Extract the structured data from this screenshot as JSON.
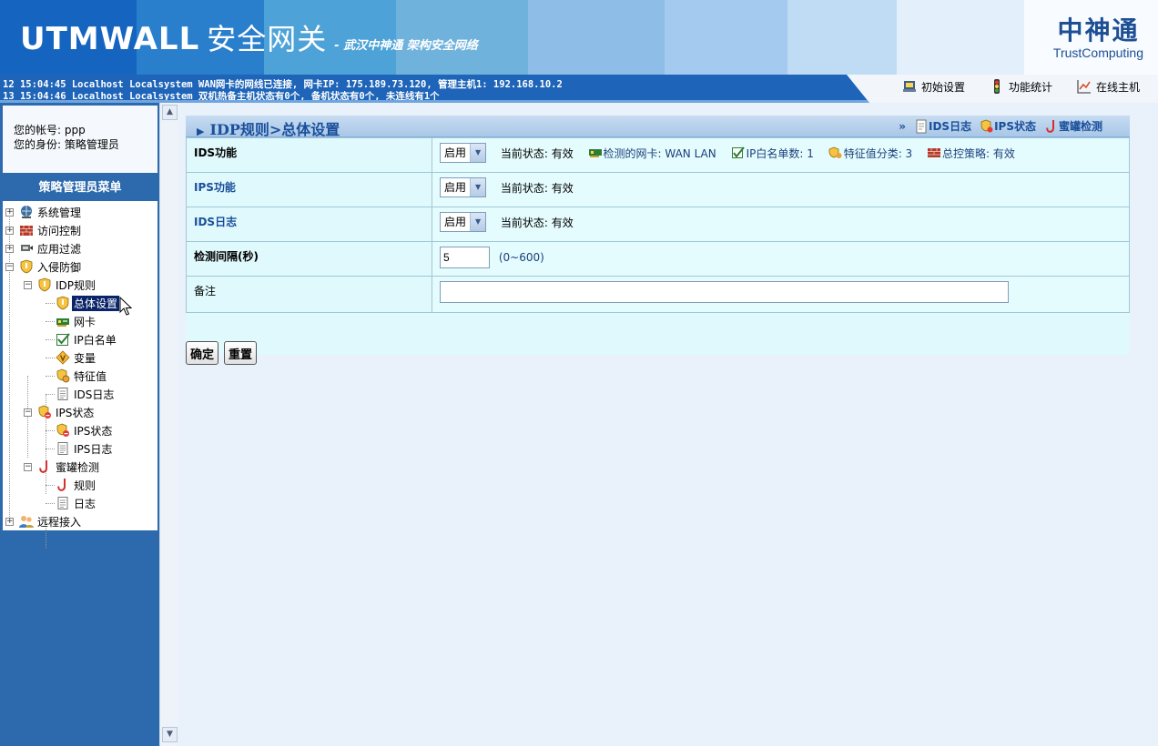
{
  "header": {
    "brand": "UTMWALL",
    "brand_cn": "安全网关",
    "slogan": "- 武汉中神通  架构安全网络",
    "logo_cn": "中神通",
    "logo_en": "TrustComputing"
  },
  "ticker": {
    "line1": "12 15:04:45 Localhost Localsystem WAN网卡的网线已连接, 网卡IP: 175.189.73.120, 管理主机1: 192.168.10.2",
    "line2": "13 15:04:46 Localhost Localsystem 双机热备主机状态有0个, 备机状态有0个, 未连线有1个"
  },
  "toplinks": [
    {
      "label": "初始设置",
      "icon": "setup-icon"
    },
    {
      "label": "功能统计",
      "icon": "traffic-light-icon"
    },
    {
      "label": "在线主机",
      "icon": "chart-icon"
    }
  ],
  "account": {
    "line1": "您的帐号: ppp",
    "line2": "您的身份: 策略管理员"
  },
  "menu_title": "策略管理员菜单",
  "tree": {
    "system": "系统管理",
    "access": "访问控制",
    "appfilter": "应用过滤",
    "intrusion": "入侵防御",
    "idp": "IDP规则",
    "overall": "总体设置",
    "nic": "网卡",
    "whitelist": "IP白名单",
    "variable": "变量",
    "signature": "特征值",
    "idslog": "IDS日志",
    "ipsstate": "IPS状态",
    "ipsstate_sub": "IPS状态",
    "ipslog": "IPS日志",
    "honeypot": "蜜罐检测",
    "rule": "规则",
    "log": "日志",
    "remote": "远程接入"
  },
  "panel": {
    "title": "IDP规则>总体设置",
    "links_prefix": "»",
    "link_idslog": "IDS日志",
    "link_ipsstate": "IPS状态",
    "link_honeypot": "蜜罐检测"
  },
  "form": {
    "ids_label": "IDS功能",
    "ids_value": "启用",
    "ids_state": "当前状态: 有效",
    "ids_nic": "检测的网卡: WAN LAN",
    "ids_whitelist": "IP白名单数: 1",
    "ids_signature": "特征值分类: 3",
    "ids_policy": "总控策略: 有效",
    "ips_label": "IPS功能",
    "ips_value": "启用",
    "ips_state": "当前状态: 有效",
    "idslog_label": "IDS日志",
    "idslog_value": "启用",
    "idslog_state": "当前状态: 有效",
    "interval_label": "检测间隔(秒)",
    "interval_value": "5",
    "interval_range": "(0~600)",
    "note_label": "备注",
    "note_value": ""
  },
  "buttons": {
    "ok": "确定",
    "reset": "重置"
  }
}
